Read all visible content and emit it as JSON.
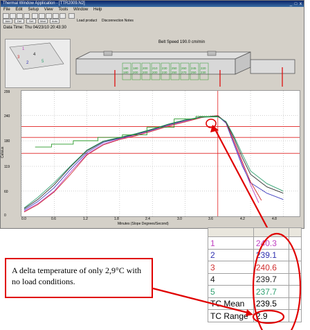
{
  "window": {
    "title": "Thermal Window Application - [TTR2009.N2]",
    "controls": "_ □ x",
    "menu": [
      "File",
      "Edit",
      "Setup",
      "View",
      "Tools",
      "Window",
      "Help"
    ],
    "toolbar_text": [
      "Load product",
      "Disconnection Notes"
    ],
    "toolbar_small": [
      "Add",
      "Del",
      "Set",
      "Mod",
      "Auto"
    ],
    "info": "Data Time: Thu 04/23/10 20:43:30",
    "belt_speed": "Belt Speed 190.0 cm/min",
    "zone_values": [
      "180\n180",
      "180\n200",
      "200\n200",
      "210\n200",
      "230\n230",
      "250\n250",
      "260\n270",
      "245\n250",
      "220\n230"
    ]
  },
  "thumbnail": {
    "legend": [
      "1",
      "2",
      "3",
      "4",
      "5"
    ]
  },
  "chart_data": {
    "type": "line",
    "xlabel": "Minutes (Slope Degrees/Second)",
    "ylabel": "Celsius",
    "x_ticks": [
      "0.0",
      "0.6",
      "1.2",
      "1.8",
      "2.4",
      "3.0",
      "3.6",
      "4.2",
      "4.8"
    ],
    "y_ticks": [
      "299",
      "240",
      "180",
      "119",
      "60",
      "0"
    ],
    "xlim": [
      0,
      5.1
    ],
    "ylim": [
      0,
      299
    ],
    "grid": true,
    "series": [
      {
        "name": "1",
        "color": "#c040c0",
        "x": [
          0.05,
          0.3,
          0.6,
          0.9,
          1.2,
          1.5,
          1.8,
          2.1,
          2.4,
          2.7,
          3.0,
          3.3,
          3.6,
          3.75,
          3.9,
          4.05,
          4.2,
          4.35
        ],
        "y": [
          12,
          30,
          60,
          105,
          148,
          172,
          184,
          193,
          204,
          216,
          226,
          236,
          240,
          224,
          175,
          125,
          75,
          32
        ]
      },
      {
        "name": "2",
        "color": "#4040c0",
        "x": [
          0.05,
          0.3,
          0.6,
          0.9,
          1.2,
          1.5,
          1.8,
          2.1,
          2.4,
          2.7,
          3.0,
          3.3,
          3.6,
          3.75,
          3.9,
          4.05,
          4.2,
          4.5,
          4.8
        ],
        "y": [
          15,
          35,
          68,
          112,
          152,
          176,
          186,
          195,
          206,
          218,
          228,
          237,
          239,
          222,
          170,
          120,
          80,
          55,
          40
        ]
      },
      {
        "name": "3",
        "color": "#d03030",
        "x": [
          0.05,
          0.3,
          0.6,
          0.9,
          1.2,
          1.5,
          1.8,
          2.1,
          2.4,
          2.7,
          3.0,
          3.3,
          3.6,
          3.75,
          3.9,
          4.05,
          4.2,
          4.4
        ],
        "y": [
          10,
          28,
          58,
          100,
          146,
          170,
          183,
          192,
          203,
          215,
          225,
          235,
          240,
          224,
          178,
          130,
          82,
          38
        ]
      },
      {
        "name": "4",
        "color": "#303030",
        "x": [
          0.05,
          0.3,
          0.6,
          0.9,
          1.2,
          1.5,
          1.8,
          2.1,
          2.4,
          2.7,
          3.0,
          3.3,
          3.6,
          3.75,
          3.9,
          4.05,
          4.2,
          4.5,
          4.8
        ],
        "y": [
          18,
          40,
          75,
          118,
          156,
          178,
          187,
          196,
          207,
          219,
          229,
          237,
          239,
          225,
          185,
          140,
          100,
          70,
          55
        ]
      },
      {
        "name": "5",
        "color": "#30a070",
        "x": [
          0.05,
          0.3,
          0.6,
          0.9,
          1.2,
          1.5,
          1.8,
          2.1,
          2.4,
          2.7,
          3.0,
          3.3,
          3.6,
          3.75,
          3.9,
          4.05,
          4.2,
          4.5,
          4.8
        ],
        "y": [
          20,
          45,
          80,
          120,
          158,
          179,
          188,
          197,
          208,
          220,
          230,
          236,
          237,
          226,
          190,
          148,
          108,
          78,
          60
        ]
      },
      {
        "name": "setpoint",
        "color": "#2a9a2a",
        "x": [
          0.25,
          0.55,
          0.55,
          0.95,
          0.95,
          1.4,
          1.4,
          1.85,
          1.85,
          2.3,
          2.3,
          2.8,
          2.8,
          3.2,
          3.2,
          3.6
        ],
        "y": [
          165,
          165,
          172,
          172,
          180,
          180,
          188,
          188,
          194,
          194,
          212,
          212,
          232,
          232,
          238,
          238
        ]
      }
    ],
    "reference_lines": {
      "color": "#e02020",
      "y": [
        214,
        188,
        150
      ]
    }
  },
  "results": {
    "rows": [
      {
        "label": "1",
        "value": "240.3",
        "label_color": "#c040c0",
        "value_color": "#c040c0"
      },
      {
        "label": "2",
        "value": "239.1",
        "label_color": "#3030b0",
        "value_color": "#3030b0"
      },
      {
        "label": "3",
        "value": "240.6",
        "label_color": "#d03030",
        "value_color": "#d03030"
      },
      {
        "label": "4",
        "value": "239.7",
        "label_color": "#222222",
        "value_color": "#222222"
      },
      {
        "label": "5",
        "value": "237.7",
        "label_color": "#30a070",
        "value_color": "#30a070"
      },
      {
        "label": "TC Mean",
        "value": "239.5",
        "label_color": "#000000",
        "value_color": "#000000"
      },
      {
        "label": "TC Range",
        "value": "2.9",
        "label_color": "#000000",
        "value_color": "#000000"
      }
    ]
  },
  "annotation": {
    "text": "A delta temperature of only 2,9°C with no load conditions.",
    "color": "#e00000"
  }
}
